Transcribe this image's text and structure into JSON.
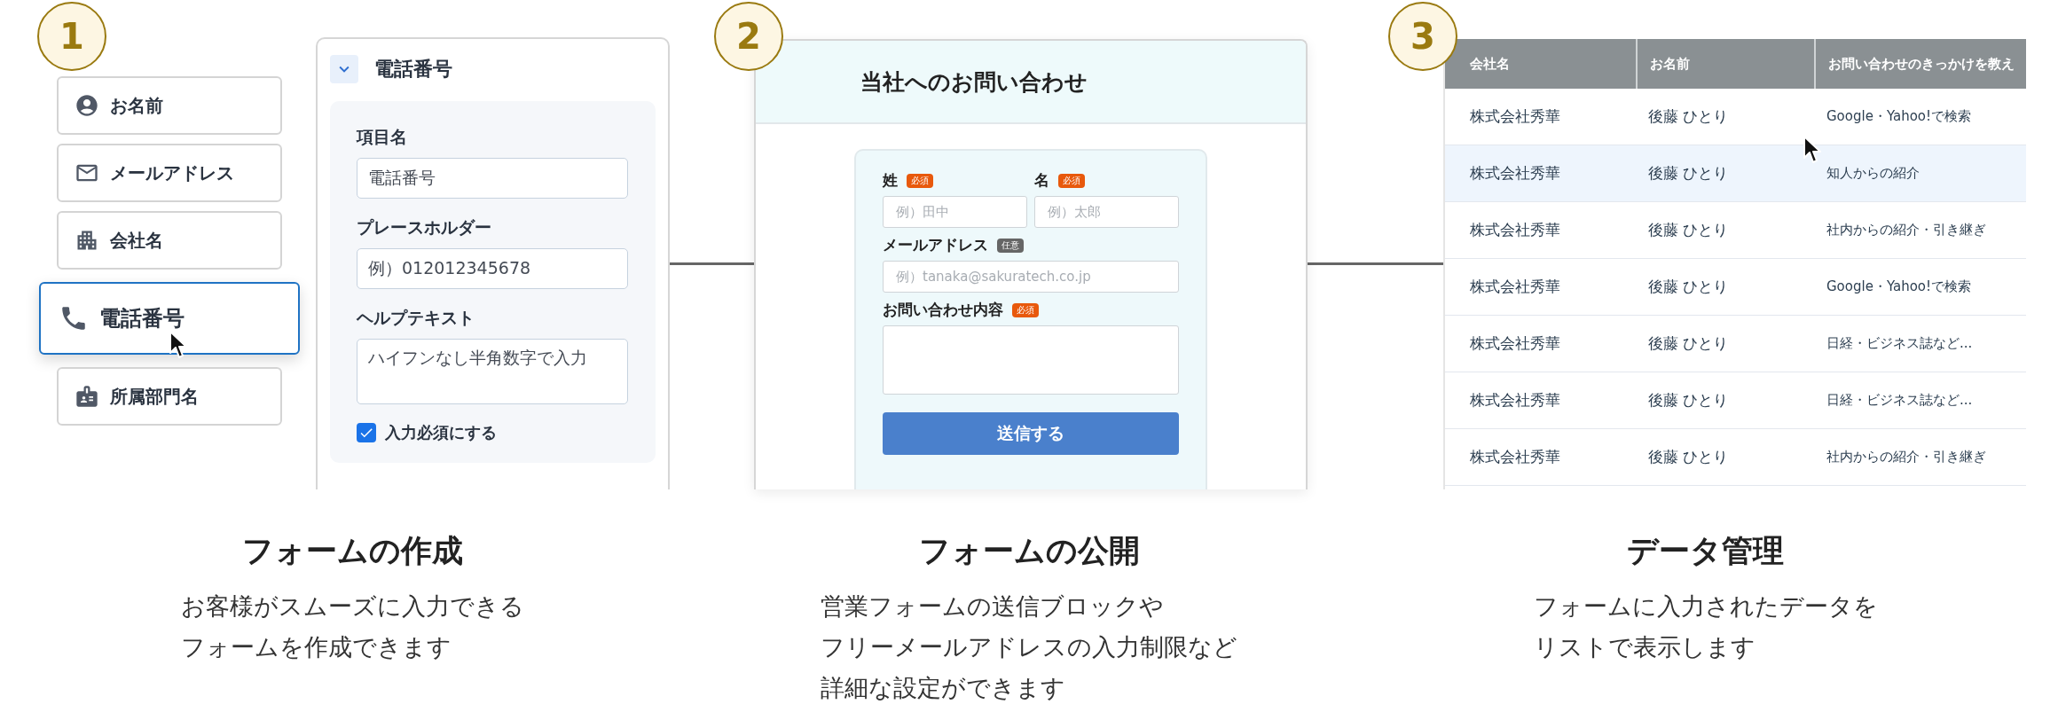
{
  "steps": [
    {
      "number": "1",
      "title": "フォームの作成",
      "description": [
        "お客様がスムーズに入力できる",
        "フォームを作成できます"
      ]
    },
    {
      "number": "2",
      "title": "フォームの公開",
      "description": [
        "営業フォームの送信ブロックや",
        "フリーメールアドレスの入力制限など",
        "詳細な設定ができます"
      ]
    },
    {
      "number": "3",
      "title": "データ管理",
      "description": [
        "フォームに入力されたデータを",
        "リストで表示します"
      ]
    }
  ],
  "field_palette": [
    {
      "label": "お名前",
      "kind": "person",
      "selected": false
    },
    {
      "label": "メールアドレス",
      "kind": "mail",
      "selected": false
    },
    {
      "label": "会社名",
      "kind": "building",
      "selected": false
    },
    {
      "label": "電話番号",
      "kind": "phone",
      "selected": true
    },
    {
      "label": "所属部門名",
      "kind": "badge",
      "selected": false
    }
  ],
  "field_editor": {
    "title": "電話番号",
    "expanded": true,
    "fields": [
      {
        "label": "項目名",
        "value": "電話番号",
        "kind": "input"
      },
      {
        "label": "プレースホルダー",
        "value": "例）012012345678",
        "kind": "input"
      },
      {
        "label": "ヘルプテキスト",
        "value": "ハイフンなし半角数字で入力",
        "kind": "textarea"
      }
    ],
    "required_option": {
      "label": "入力必須にする",
      "checked": true
    }
  },
  "contact_form": {
    "title": "当社へのお問い合わせ",
    "rows": [
      {
        "fields": [
          {
            "label": "姓",
            "tag": {
              "text": "必須",
              "kind": "required"
            },
            "placeholder": "例）田中",
            "kind": "input"
          },
          {
            "label": "名",
            "tag": {
              "text": "必須",
              "kind": "required"
            },
            "placeholder": "例）太郎",
            "kind": "input"
          }
        ]
      },
      {
        "fields": [
          {
            "label": "メールアドレス",
            "tag": {
              "text": "任意",
              "kind": "optional"
            },
            "placeholder": "例）tanaka@sakuratech.co.jp",
            "kind": "input"
          }
        ]
      },
      {
        "fields": [
          {
            "label": "お問い合わせ内容",
            "tag": {
              "text": "必須",
              "kind": "required"
            },
            "kind": "textarea"
          }
        ]
      }
    ],
    "submit": "送信する"
  },
  "table": {
    "columns": [
      "会社名",
      "お名前",
      "お問い合わせのきっかけを教え"
    ],
    "rows": [
      {
        "cells": [
          "株式会社秀華",
          "後藤 ひとり",
          "Google・Yahoo!で検索"
        ],
        "selected": false
      },
      {
        "cells": [
          "株式会社秀華",
          "後藤 ひとり",
          "知人からの紹介"
        ],
        "selected": true
      },
      {
        "cells": [
          "株式会社秀華",
          "後藤 ひとり",
          "社内からの紹介・引き継ぎ"
        ],
        "selected": false
      },
      {
        "cells": [
          "株式会社秀華",
          "後藤 ひとり",
          "Google・Yahoo!で検索"
        ],
        "selected": false
      },
      {
        "cells": [
          "株式会社秀華",
          "後藤 ひとり",
          "日経・ビジネス誌など..."
        ],
        "selected": false
      },
      {
        "cells": [
          "株式会社秀華",
          "後藤 ひとり",
          "日経・ビジネス誌など..."
        ],
        "selected": false
      },
      {
        "cells": [
          "株式会社秀華",
          "後藤 ひとり",
          "社内からの紹介・引き継ぎ"
        ],
        "selected": false
      }
    ]
  }
}
